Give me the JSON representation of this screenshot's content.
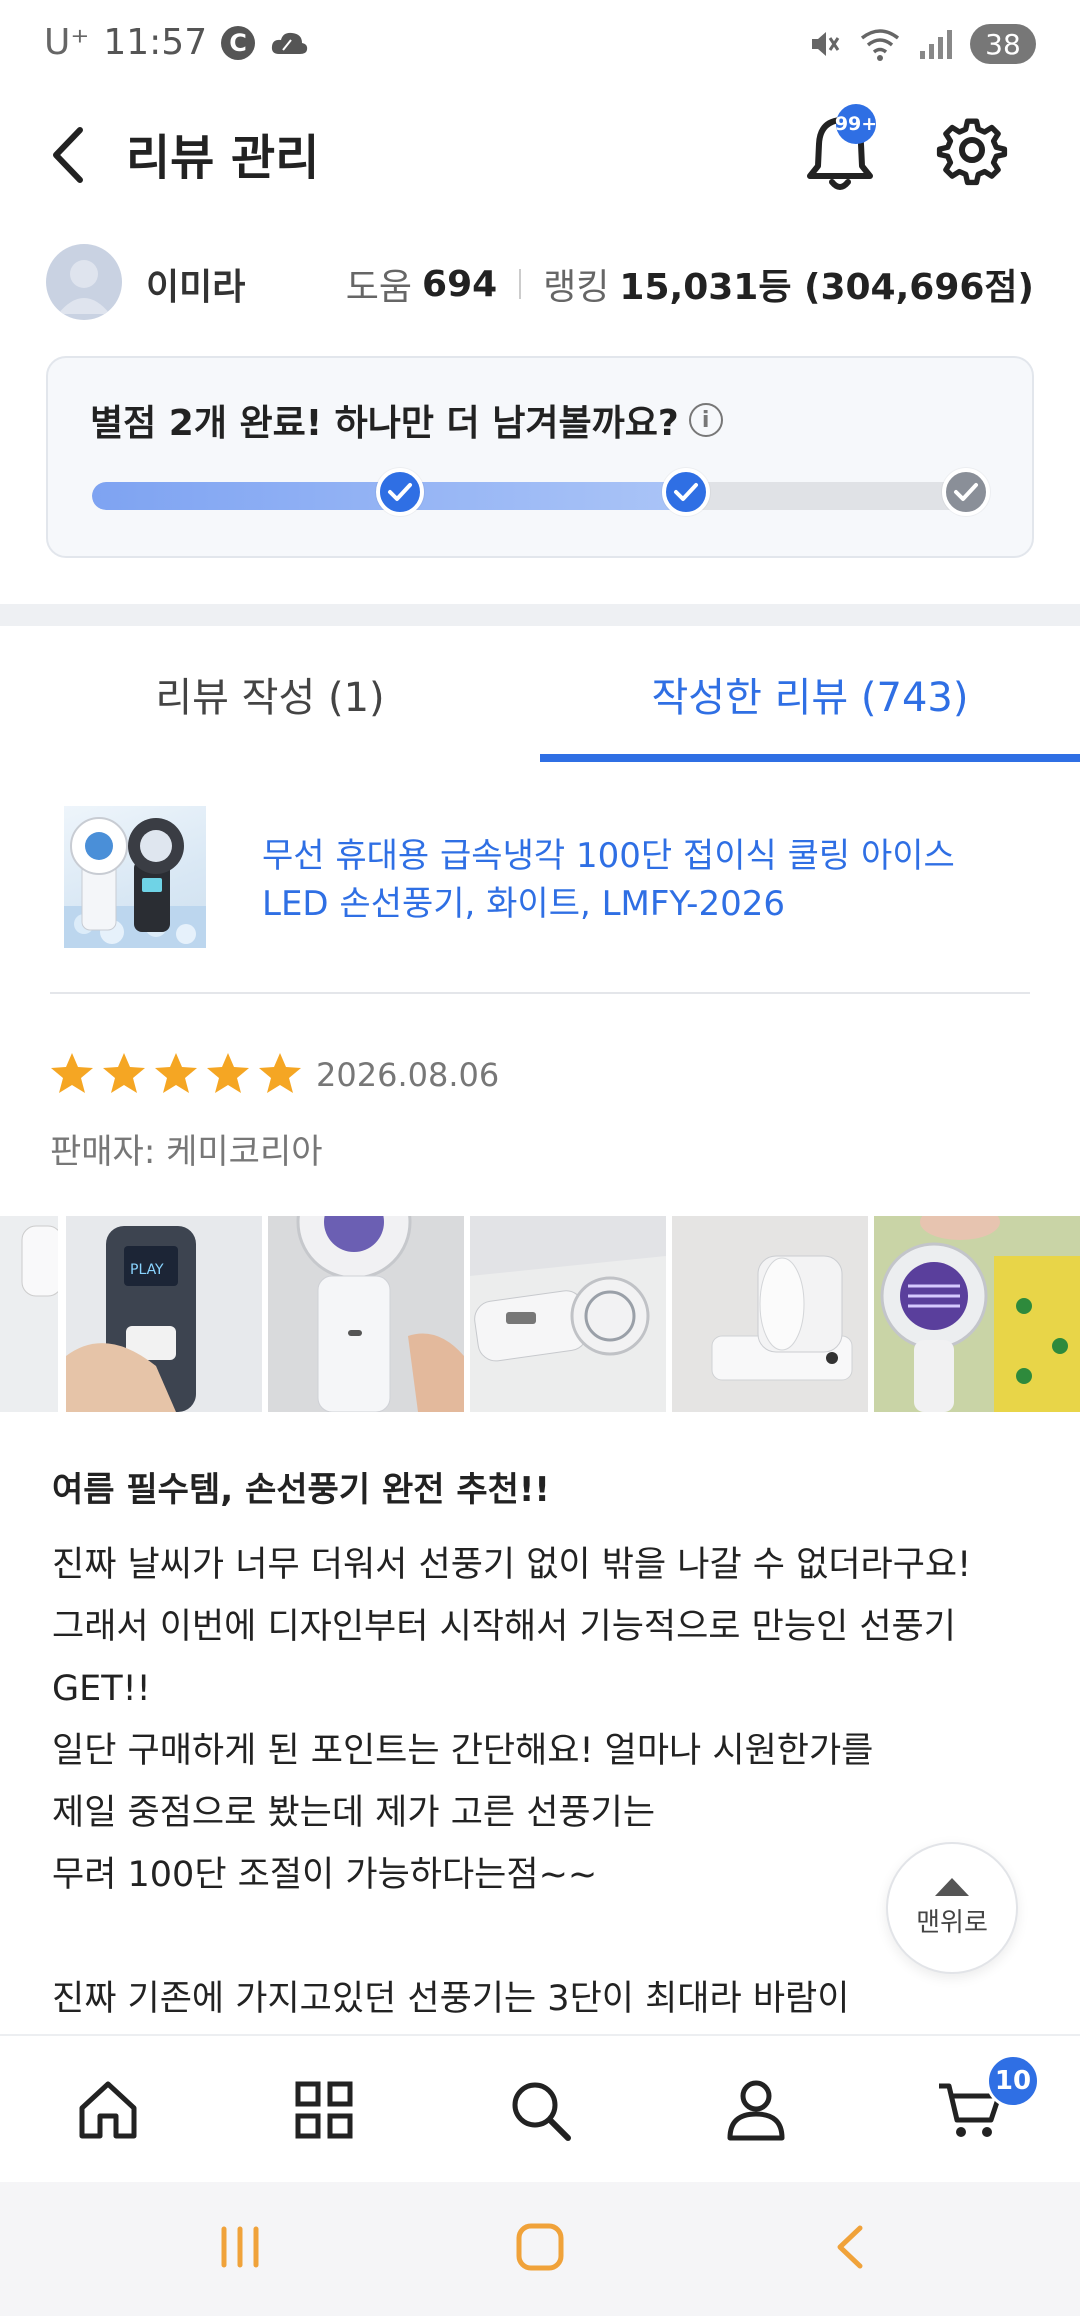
{
  "status_bar": {
    "carrier": "U⁺",
    "time": "11:57",
    "c_badge": "C",
    "battery": "38"
  },
  "header": {
    "title": "리뷰 관리",
    "notification_badge": "99+"
  },
  "profile": {
    "name": "이미라",
    "help_label": "도움",
    "help_value": "694",
    "rank_label": "랭킹",
    "rank_value": "15,031등 (304,696점)"
  },
  "progress": {
    "title": "별점 2개 완료! 하나만 더 남겨볼까요?",
    "completed": 2,
    "total": 3,
    "fill_fraction": 0.66
  },
  "tabs": [
    {
      "label": "리뷰 작성 (1)",
      "active": false
    },
    {
      "label": "작성한 리뷰 (743)",
      "active": true
    }
  ],
  "product": {
    "name": "무선 휴대용 급속냉각 100단 접이식 쿨링 아이스 LED 손선풍기, 화이트, LMFY-2026"
  },
  "review": {
    "rating": 5,
    "date": "2026.08.06",
    "seller": "판매자: 케미코리아",
    "title": "여름 필수템, 손선풍기 완전 추천!!",
    "body_lines": [
      "진짜 날씨가 너무 더워서 선풍기 없이 밖을 나갈 수 없더라구요!",
      "그래서 이번에 디자인부터 시작해서 기능적으로 만능인 선풍기",
      "GET!!",
      "일단 구매하게 된 포인트는 간단해요! 얼마나 시원한가를",
      "제일 중점으로 봤는데 제가 고른 선풍기는",
      "무려 100단 조절이 가능하다는점~~",
      "",
      "진짜 기존에 가지고있던 선풍기는 3단이 최대라 바람이"
    ]
  },
  "top_button": {
    "label": "맨위로"
  },
  "bottom_nav": {
    "items": [
      "home-icon",
      "grid-icon",
      "search-icon",
      "person-icon",
      "cart-icon"
    ],
    "cart_count": "10"
  },
  "colors": {
    "accent": "#2f6fe4",
    "star": "#f5a623",
    "sys_nav_icon": "#f0a23a"
  }
}
